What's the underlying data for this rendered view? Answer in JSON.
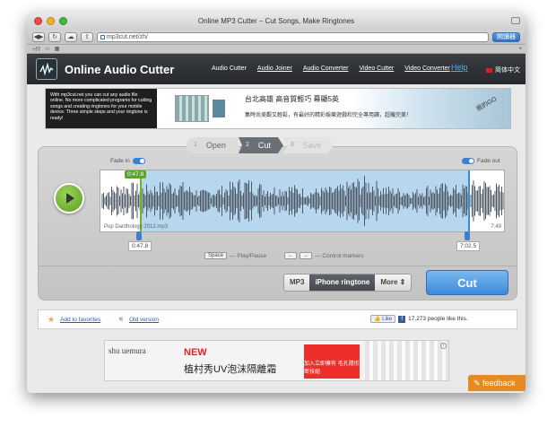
{
  "window": {
    "title": "Online MP3 Cutter – Cut Songs, Make Ringtones"
  },
  "browser": {
    "url": "mp3cut.net/zh/",
    "search_button": "開讀器",
    "bookmark_items": [
      "ｯｸﾏ",
      "▭",
      "▦"
    ],
    "new_tab": "+"
  },
  "header": {
    "brand": "Online Audio Cutter",
    "nav": [
      "Audio Cutter",
      "Audio Joiner",
      "Audio Converter",
      "Video Cutter",
      "Video Converter"
    ],
    "help": "Help",
    "language": "简体中文"
  },
  "ad_top": {
    "text": "With mp3cut.net you can cut any audio file online. No more complicated programs for cutting songs and creating ringtones for your mobile device. Three simple steps and your ringtone is ready!",
    "headline": "台北高雄 高音質輕巧 幕顯5英",
    "subline": "集時尚美觀又輕鬆，有最好的精彩娛樂遊戲和完全專用讀，超機完美！",
    "badge": "我的GO"
  },
  "steps": [
    {
      "num": "1",
      "label": "Open"
    },
    {
      "num": "2",
      "label": "Cut"
    },
    {
      "num": "3",
      "label": "Save"
    }
  ],
  "editor": {
    "fade_in": "Fade in",
    "fade_out": "Fade out",
    "start_time_top": "0:47.8",
    "file_name": "Pop Danthology 2012.mp3",
    "duration": "7:49",
    "start_time": "0:47.8",
    "end_time": "7:02.5",
    "hint_play_key": "Space",
    "hint_play": "— Play/Pause",
    "hint_markers_keys": [
      "←",
      "→"
    ],
    "hint_markers": "— Control markers",
    "formats": [
      "MP3",
      "iPhone ringtone",
      "More ⇕"
    ],
    "cut_label": "Cut"
  },
  "favbar": {
    "favorites": "Add to favorites",
    "old_version": "Old version",
    "like_button": "Like",
    "likes_text": "17,273 people like this."
  },
  "ad_bottom": {
    "brand": "shu uemura",
    "new_label": "NEW",
    "title": "植村秀UV泡沫隔離霜",
    "box_text": "加入立即擁有 毛孔隱形密技組"
  },
  "feedback": "feedback",
  "colors": {
    "accent": "#3d8ad9",
    "selection": "#b7d7ef",
    "start_marker": "#6bb520",
    "header": "#2b2d31"
  }
}
